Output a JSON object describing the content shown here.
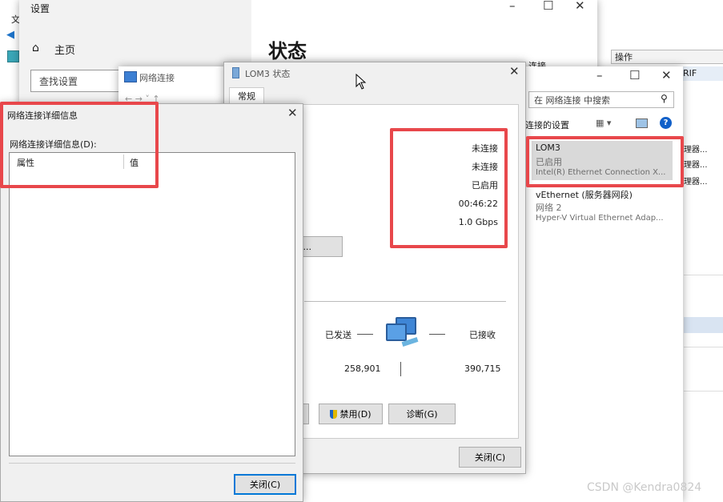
{
  "back_app": {
    "menu_fragment": "文",
    "right_panel_header": "操作",
    "right_panel_fragment": "RIF",
    "right_items": [
      "理器...",
      "理器...",
      "理器..."
    ]
  },
  "settings": {
    "title": "设置",
    "home_label": "主页",
    "search_placeholder": "查找设置",
    "page_heading": "状态",
    "fragment": "连接"
  },
  "netconn": {
    "title": "网络连接",
    "search_placeholder": "在 网络连接 中搜索",
    "change_settings": "连接的设置",
    "adapters": [
      {
        "name": "LOM3",
        "status": "已启用",
        "device": "Intel(R) Ethernet Connection X..."
      },
      {
        "name": "vEthernet (服务器网段)",
        "status": "网络 2",
        "device": "Hyper-V Virtual Ethernet Adap..."
      }
    ]
  },
  "status_dialog": {
    "title": "LOM3 状态",
    "tab_general": "常规",
    "values": [
      "未连接",
      "未连接",
      "已启用",
      "00:46:22",
      "1.0 Gbps"
    ],
    "details_button_fragment": "(E)...",
    "sent_label": "已发送",
    "received_label": "已接收",
    "sent_bytes": "258,901",
    "received_bytes": "390,715",
    "disable_button": "禁用(D)",
    "diagnose_button": "诊断(G)",
    "close_button": "关闭(C)"
  },
  "details_dialog": {
    "title": "网络连接详细信息",
    "list_label": "网络连接详细信息(D):",
    "col_property": "属性",
    "col_value": "值",
    "close_button": "关闭(C)"
  },
  "watermark": "CSDN @Kendra0824",
  "colors": {
    "annotation_red": "#e8474b",
    "accent_blue": "#0078d7",
    "selected_row": "#cce8ff"
  }
}
